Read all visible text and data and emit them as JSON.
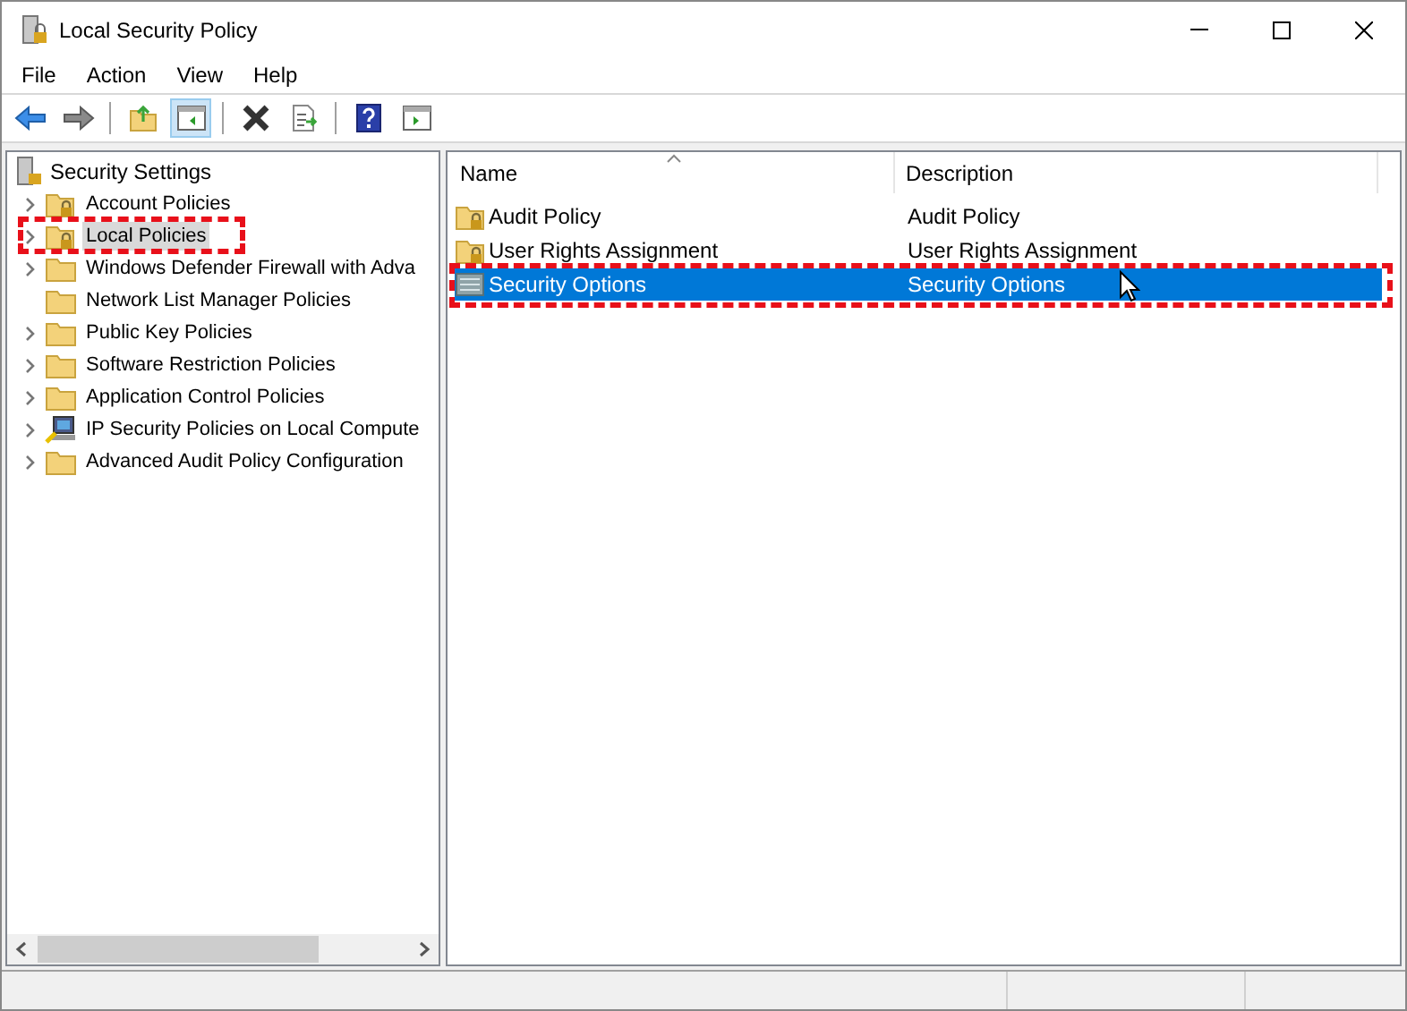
{
  "window": {
    "title": "Local Security Policy"
  },
  "menu": [
    "File",
    "Action",
    "View",
    "Help"
  ],
  "toolbar": [
    {
      "kind": "back",
      "pressed": false
    },
    {
      "kind": "forward",
      "pressed": false
    },
    {
      "kind": "sep"
    },
    {
      "kind": "up",
      "pressed": false
    },
    {
      "kind": "tree",
      "pressed": true
    },
    {
      "kind": "sep"
    },
    {
      "kind": "delete",
      "pressed": false
    },
    {
      "kind": "export",
      "pressed": false
    },
    {
      "kind": "sep"
    },
    {
      "kind": "help",
      "pressed": false
    },
    {
      "kind": "pane",
      "pressed": false
    }
  ],
  "tree": {
    "label": "Security Settings",
    "children": [
      {
        "label": "Account Policies",
        "kind": "locked-folder",
        "expandable": true,
        "selected": false,
        "highlighted": false
      },
      {
        "label": "Local Policies",
        "kind": "locked-folder",
        "expandable": true,
        "selected": true,
        "highlighted": true
      },
      {
        "label": "Windows Defender Firewall with Adva",
        "kind": "folder",
        "expandable": true,
        "selected": false,
        "highlighted": false
      },
      {
        "label": "Network List Manager Policies",
        "kind": "folder",
        "expandable": false,
        "selected": false,
        "highlighted": false
      },
      {
        "label": "Public Key Policies",
        "kind": "folder",
        "expandable": true,
        "selected": false,
        "highlighted": false
      },
      {
        "label": "Software Restriction Policies",
        "kind": "folder",
        "expandable": true,
        "selected": false,
        "highlighted": false
      },
      {
        "label": "Application Control Policies",
        "kind": "folder",
        "expandable": true,
        "selected": false,
        "highlighted": false
      },
      {
        "label": "IP Security Policies on Local Compute",
        "kind": "computer",
        "expandable": true,
        "selected": false,
        "highlighted": false
      },
      {
        "label": "Advanced Audit Policy Configuration",
        "kind": "folder",
        "expandable": true,
        "selected": false,
        "highlighted": false
      }
    ]
  },
  "table": {
    "columns": [
      "Name",
      "Description"
    ],
    "rows": [
      {
        "name": "Audit Policy",
        "description": "Audit Policy",
        "kind": "locked-folder",
        "selected": false,
        "highlighted": false
      },
      {
        "name": "User Rights Assignment",
        "description": "User Rights Assignment",
        "kind": "locked-folder",
        "selected": false,
        "highlighted": false
      },
      {
        "name": "Security Options",
        "description": "Security Options",
        "kind": "options",
        "selected": true,
        "highlighted": true
      }
    ]
  }
}
